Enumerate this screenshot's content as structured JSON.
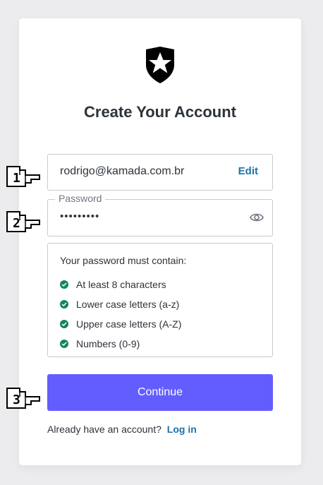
{
  "page": {
    "title": "Create Your Account"
  },
  "email_field": {
    "value": "rodrigo@kamada.com.br",
    "edit_label": "Edit"
  },
  "password_field": {
    "label": "Password",
    "value": "•••••••••",
    "toggle_icon": "eye-icon"
  },
  "requirements": {
    "heading": "Your password must contain:",
    "items": [
      {
        "label": "At least 8 characters",
        "icon": "check-circle-icon"
      },
      {
        "label": "Lower case letters (a-z)",
        "icon": "check-circle-icon"
      },
      {
        "label": "Upper case letters (A-Z)",
        "icon": "check-circle-icon"
      },
      {
        "label": "Numbers (0-9)",
        "icon": "check-circle-icon"
      }
    ]
  },
  "continue_button": {
    "label": "Continue"
  },
  "login_prompt": {
    "text": "Already have an account?",
    "link_label": "Log in"
  },
  "step_markers": [
    "1",
    "2",
    "3"
  ],
  "colors": {
    "primary": "#635dff",
    "link": "#1a73a8",
    "success": "#12865b",
    "background": "#ececee"
  }
}
